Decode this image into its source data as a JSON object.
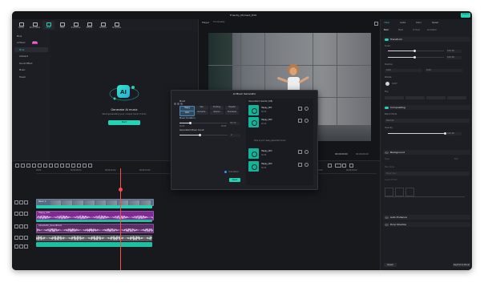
{
  "titlebar": {
    "title": "Friendly_Moment_Edit",
    "export_label": "Export"
  },
  "toolbar": {
    "items": [
      {
        "label": "Media",
        "icon": "media-icon"
      },
      {
        "label": "Stock Media",
        "icon": "stock-media-icon"
      },
      {
        "label": "Audio",
        "icon": "music-icon"
      },
      {
        "label": "Titles",
        "icon": "titles-icon"
      },
      {
        "label": "Transitions",
        "icon": "transitions-icon"
      },
      {
        "label": "Effects",
        "icon": "effects-icon"
      },
      {
        "label": "Stickers",
        "icon": "stickers-icon"
      },
      {
        "label": "Templates",
        "icon": "templates-icon"
      }
    ]
  },
  "left_nav": {
    "items": [
      {
        "label": "Mine"
      },
      {
        "label": "AI Music",
        "badge": "NEW"
      },
      {
        "label": "Mine"
      },
      {
        "label": "Ambient"
      },
      {
        "label": "Sound Effect"
      },
      {
        "label": "Music"
      },
      {
        "label": "Travel"
      }
    ]
  },
  "media_panel": {
    "empty_title": "Generate AI music",
    "empty_subtitle": "Start generating your unique music tracks",
    "start_button": "Start"
  },
  "player": {
    "label": "Player",
    "quality": "Full Quality",
    "current_time": "00:00:00:00",
    "total_time": "00:00:06:20"
  },
  "dialog": {
    "title": "AI Music Generator",
    "mood_label": "Mood",
    "mood_options": [
      "Happy",
      "Sad",
      "Exciting",
      "Hopeful"
    ],
    "genre_options": [
      "Calm",
      "Romantic",
      "Tension",
      "Emotional"
    ],
    "duration_label": "Music Duration",
    "duration_value": "00:30",
    "duration_min": "00:05",
    "duration_max": "05:00",
    "count_label": "Generated Music Count",
    "count_value": "2",
    "results_header": "Generated results (4/8)",
    "tracks": [
      {
        "name": "Happy_001",
        "duration": "00:30"
      },
      {
        "name": "Happy_002",
        "duration": "00:30"
      },
      {
        "name": "Happy_003",
        "duration": "00:30"
      },
      {
        "name": "Happy_004",
        "duration": "00:30"
      }
    ],
    "divider_text": "Here is your newly generated music",
    "unlimited_label": "Unlimited",
    "generate_button": "Start"
  },
  "right_panel": {
    "tabs": [
      "Video",
      "Audio",
      "Color",
      "Speed"
    ],
    "subtabs": [
      "Basic",
      "Mask",
      "AI Tools",
      "Animation"
    ],
    "transform_label": "Transform",
    "scale_label": "Scale",
    "scale_x": "100.00",
    "scale_y": "100.00",
    "position_label": "Position",
    "pos_x": "0.00",
    "pos_y": "0.00",
    "rotate_label": "Rotate",
    "rotate_value": "0.00°",
    "flip_label": "Flip",
    "compositing_label": "Compositing",
    "blend_label": "Blend Mode",
    "blend_value": "Normal",
    "opacity_label": "Opacity",
    "opacity_value": "100.00",
    "background_label": "Background",
    "type_label": "Type",
    "type_value": "Blur",
    "blur_label": "Blur style",
    "blur_value": "Basic blur",
    "level_label": "Level of blur",
    "auto_enhance_label": "Auto Enhance",
    "drop_shadow_label": "Drop Shadow",
    "reset_button": "Reset",
    "keyframe_button": "Keyframe Panel"
  },
  "timeline": {
    "ruler": [
      "00:00",
      "00:00:05:00",
      "00:00:10:00",
      "00:00:15:00",
      "00:00:20:00",
      "00:00:25:00",
      "00:00:30:00",
      "00:00:35:00",
      "00:00:40:00",
      "00:00:45:00"
    ],
    "title_clip": "Basic 1",
    "audio_clip_1": "Happy_001",
    "audio_clip_2": "Cinematic_Soundtrack"
  }
}
